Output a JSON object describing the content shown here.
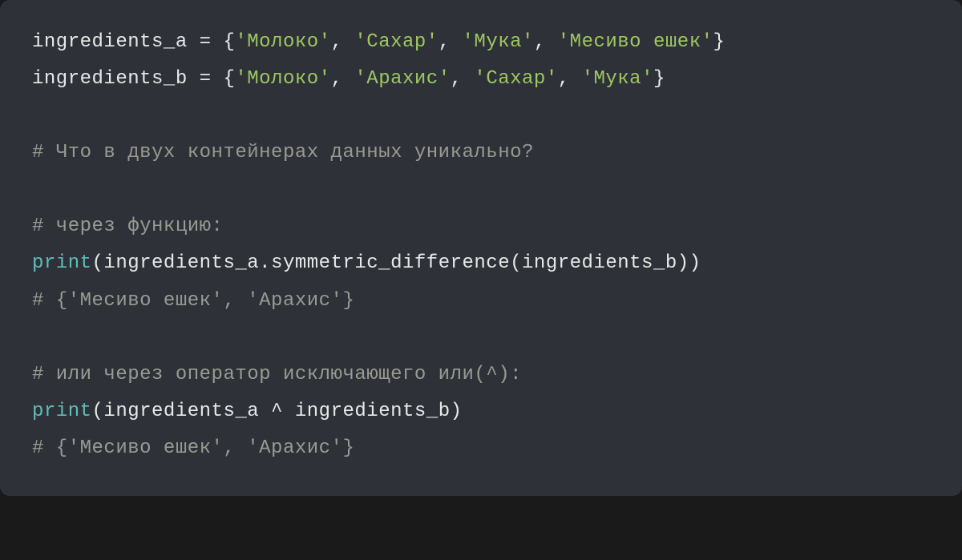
{
  "code": {
    "line1": {
      "var": "ingredients_a",
      "eq": " = ",
      "open": "{",
      "s1": "'Молоко'",
      "c1": ", ",
      "s2": "'Сахар'",
      "c2": ", ",
      "s3": "'Мука'",
      "c3": ", ",
      "s4": "'Месиво ешек'",
      "close": "}"
    },
    "line2": {
      "var": "ingredients_b",
      "eq": " = ",
      "open": "{",
      "s1": "'Молоко'",
      "c1": ", ",
      "s2": "'Арахис'",
      "c2": ", ",
      "s3": "'Сахар'",
      "c3": ", ",
      "s4": "'Мука'",
      "close": "}"
    },
    "line3": "",
    "line4": "# Что в двух контейнерах данных уникально?",
    "line5": "",
    "line6": "# через функцию:",
    "line7": {
      "fn": "print",
      "open": "(",
      "arg1": "ingredients_a",
      "dot": ".",
      "method": "symmetric_difference",
      "open2": "(",
      "arg2": "ingredients_b",
      "close2": ")",
      "close": ")"
    },
    "line8": "# {'Месиво ешек', 'Арахис'}",
    "line9": "",
    "line10": "# или через оператор исключающего или(^):",
    "line11": {
      "fn": "print",
      "open": "(",
      "arg1": "ingredients_a",
      "op": " ^ ",
      "arg2": "ingredients_b",
      "close": ")"
    },
    "line12": "# {'Месиво ешек', 'Арахис'}"
  }
}
